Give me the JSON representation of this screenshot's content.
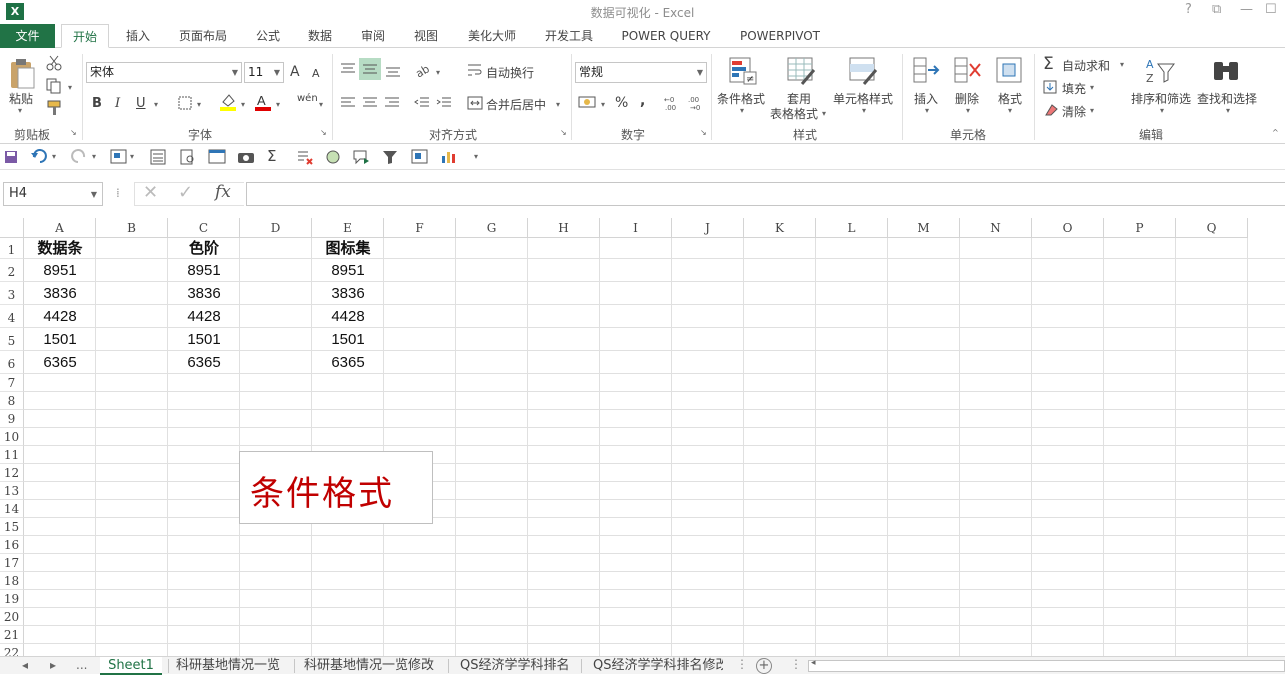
{
  "window": {
    "title": "数据可视化 - Excel",
    "help": "?",
    "restore": "⧉",
    "minimize": "—",
    "maximize": "☐"
  },
  "tabs": [
    "文件",
    "开始",
    "插入",
    "页面布局",
    "公式",
    "数据",
    "审阅",
    "视图",
    "美化大师",
    "开发工具",
    "POWER QUERY",
    "POWERPIVOT"
  ],
  "ribbon": {
    "clipboard": {
      "paste": "粘贴",
      "group": "剪贴板"
    },
    "font": {
      "name": "宋体",
      "size": "11",
      "group": "字体",
      "bold": "B",
      "italic": "I",
      "underline": "U",
      "grow": "A",
      "shrink": "A",
      "phonetic": "wén"
    },
    "alignment": {
      "wrap": "自动换行",
      "merge": "合并后居中",
      "group": "对齐方式"
    },
    "number": {
      "format": "常规",
      "group": "数字",
      "percent": "%",
      "comma": ","
    },
    "styles": {
      "conditional": "条件格式",
      "table_1": "套用",
      "table_2": "表格格式",
      "cell_styles": "单元格样式",
      "group": "样式"
    },
    "cells": {
      "insert": "插入",
      "delete": "删除",
      "format": "格式",
      "group": "单元格"
    },
    "editing": {
      "autosum": "自动求和",
      "fill": "填充",
      "clear": "清除",
      "sort": "排序和筛选",
      "find": "查找和选择",
      "group": "编辑"
    }
  },
  "formula_bar": {
    "name_box": "H4",
    "formula": "",
    "fx": "fx"
  },
  "columns": [
    "A",
    "B",
    "C",
    "D",
    "E",
    "F",
    "G",
    "H",
    "I",
    "J",
    "K",
    "L",
    "M",
    "N",
    "O",
    "P",
    "Q"
  ],
  "rows": [
    "1",
    "2",
    "3",
    "4",
    "5",
    "6",
    "7",
    "8",
    "9",
    "10",
    "11",
    "12",
    "13",
    "14",
    "15",
    "16",
    "17",
    "18",
    "19",
    "20",
    "21",
    "22"
  ],
  "table": {
    "A": [
      "数据条",
      "8951",
      "3836",
      "4428",
      "1501",
      "6365"
    ],
    "C": [
      "色阶",
      "8951",
      "3836",
      "4428",
      "1501",
      "6365"
    ],
    "E": [
      "图标集",
      "8951",
      "3836",
      "4428",
      "1501",
      "6365"
    ]
  },
  "textbox": "条件格式",
  "sheets": [
    "Sheet1",
    "科研基地情况一览",
    "科研基地情况一览修改",
    "QS经济学学科排名",
    "QS经济学学科排名修改"
  ],
  "sheet_nav": {
    "prev": "◂",
    "next": "▸",
    "more": "...",
    "add": "+"
  },
  "colors": {
    "accent": "#217346",
    "textbox_text": "#c00000"
  }
}
